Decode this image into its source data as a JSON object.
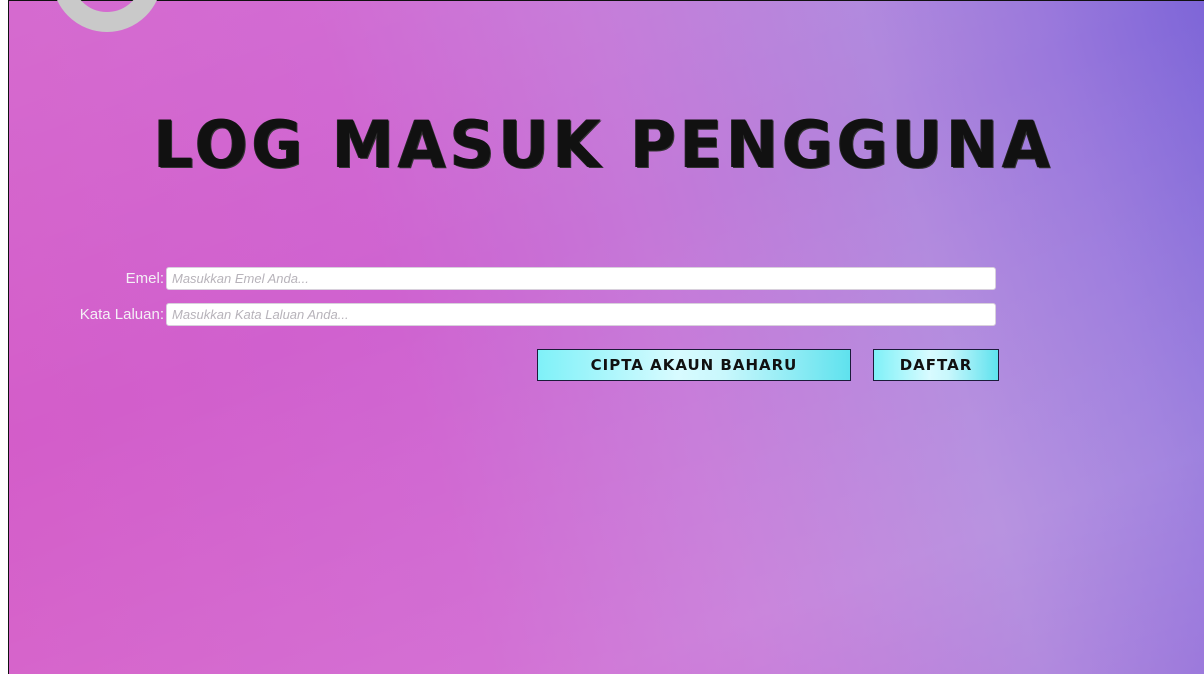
{
  "page": {
    "title": "LOG MASUK PENGGUNA"
  },
  "form": {
    "email": {
      "label": "Emel:",
      "placeholder": "Masukkan Emel Anda...",
      "value": ""
    },
    "password": {
      "label": "Kata Laluan:",
      "placeholder": "Masukkan Kata Laluan Anda...",
      "value": ""
    }
  },
  "actions": {
    "create_account_label": "CIPTA AKAUN BAHARU",
    "register_label": "DAFTAR"
  },
  "colors": {
    "background_start": "#d45cc8",
    "background_end": "#7e66d8",
    "button_accent": "#7ff1f8",
    "title_text": "#111111",
    "decor_ring": "#c9c9c9"
  },
  "icons": {
    "top_left_decoration": "ring-icon"
  }
}
